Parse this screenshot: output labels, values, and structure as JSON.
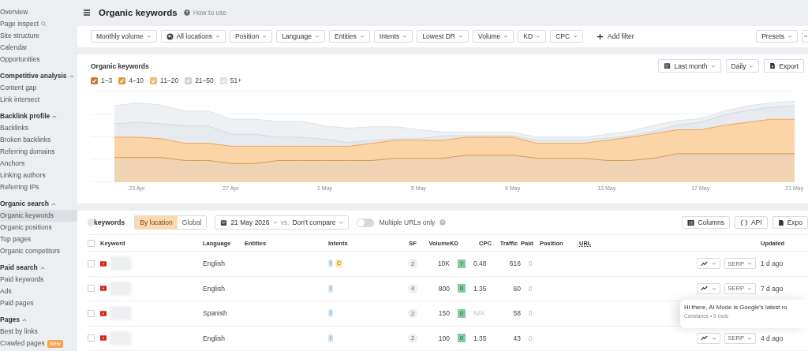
{
  "sidebar": {
    "sections": [
      {
        "items": [
          {
            "label": "Overview",
            "kind": "plain",
            "selected": false
          },
          {
            "label": "Page inspect",
            "kind": "search",
            "selected": false
          },
          {
            "label": "Site structure",
            "kind": "plain",
            "selected": false
          },
          {
            "label": "Calendar",
            "kind": "plain",
            "selected": false
          },
          {
            "label": "Opportunities",
            "kind": "plain",
            "selected": false
          }
        ]
      },
      {
        "heading": "Competitive analysis",
        "expanded": true,
        "items": [
          {
            "label": "Content gap",
            "kind": "plain",
            "selected": false
          },
          {
            "label": "Link intersect",
            "kind": "plain",
            "selected": false
          }
        ]
      },
      {
        "heading": "Backlink profile",
        "expanded": true,
        "items": [
          {
            "label": "Backlinks",
            "kind": "plain",
            "selected": false
          },
          {
            "label": "Broken backlinks",
            "kind": "plain",
            "selected": false
          },
          {
            "label": "Referring domains",
            "kind": "plain",
            "selected": false
          },
          {
            "label": "Anchors",
            "kind": "plain",
            "selected": false
          },
          {
            "label": "Linking authors",
            "kind": "plain",
            "selected": false
          },
          {
            "label": "Referring IPs",
            "kind": "plain",
            "selected": false
          }
        ]
      },
      {
        "heading": "Organic search",
        "expanded": true,
        "items": [
          {
            "label": "Organic keywords",
            "kind": "plain",
            "selected": true
          },
          {
            "label": "Organic positions",
            "kind": "plain",
            "selected": false
          },
          {
            "label": "Top pages",
            "kind": "plain",
            "selected": false
          },
          {
            "label": "Organic competitors",
            "kind": "plain",
            "selected": false
          }
        ]
      },
      {
        "heading": "Paid search",
        "expanded": true,
        "items": [
          {
            "label": "Paid keywords",
            "kind": "plain",
            "selected": false
          },
          {
            "label": "Ads",
            "kind": "plain",
            "selected": false
          },
          {
            "label": "Paid pages",
            "kind": "plain",
            "selected": false
          }
        ]
      },
      {
        "heading": "Pages",
        "expanded": true,
        "items": [
          {
            "label": "Best by links",
            "kind": "plain",
            "selected": false
          },
          {
            "label": "Crawled pages",
            "kind": "plain",
            "selected": false,
            "badge": "New"
          }
        ]
      }
    ]
  },
  "header": {
    "title": "Organic keywords",
    "help": "How to use"
  },
  "filters": [
    {
      "label": "Monthly volume",
      "kind": "dropdown"
    },
    {
      "label": "All locations",
      "kind": "location"
    },
    {
      "label": "Position",
      "kind": "dropdown"
    },
    {
      "label": "Language",
      "kind": "dropdown"
    },
    {
      "label": "Entities",
      "kind": "dropdown"
    },
    {
      "label": "Intents",
      "kind": "dropdown"
    },
    {
      "label": "Lowest DR",
      "kind": "dropdown"
    },
    {
      "label": "Volume",
      "kind": "dropdown"
    },
    {
      "label": "KD",
      "kind": "dropdown"
    },
    {
      "label": "CPC",
      "kind": "dropdown"
    }
  ],
  "add_filter": "Add filter",
  "presets": "Presets",
  "chart_card": {
    "title": "Organic keywords",
    "legend": [
      {
        "label": "1–3",
        "color": "#c8792a"
      },
      {
        "label": "4–10",
        "color": "#e8973c"
      },
      {
        "label": "11–20",
        "color": "#f5b66a"
      },
      {
        "label": "21–50",
        "color": "#c9d3de"
      },
      {
        "label": "51+",
        "color": "#dde3ea"
      }
    ],
    "period": "Last month",
    "interval": "Daily",
    "export": "Export",
    "x_labels": [
      "23 Apr",
      "27 Apr",
      "1 May",
      "5 May",
      "9 May",
      "13 May",
      "17 May",
      "21 May"
    ]
  },
  "table": {
    "title": "keywords",
    "scope": [
      {
        "label": "By location",
        "selected": true
      },
      {
        "label": "Global",
        "selected": false
      }
    ],
    "date": "21 May 2026",
    "vs": "vs.",
    "compare": "Don't compare",
    "multiple_urls": {
      "label": "Multiple URLs only",
      "on": false
    },
    "buttons": [
      {
        "label": "Columns",
        "kind": "columns"
      },
      {
        "label": "API",
        "kind": "api"
      },
      {
        "label": "Expo",
        "kind": "export"
      }
    ],
    "all_checked": false,
    "columns": [
      "Keyword",
      "Language",
      "Entities",
      "Intents",
      "SF",
      "Volume",
      "KD",
      "CPC",
      "Traffic",
      "Paid",
      "Position",
      "URL",
      "Updated"
    ],
    "rows": [
      {
        "checked": false,
        "language": "English",
        "intents": [
          {
            "label": "I",
            "kind": "informational"
          },
          {
            "label": "C",
            "kind": "commercial"
          }
        ],
        "sf": "2",
        "volume": "10K",
        "kd": "7",
        "cpc": "0.48",
        "cpc_available": true,
        "traffic": "616",
        "paid": "0",
        "serp": "SERP",
        "updated": "1 d ago"
      },
      {
        "checked": false,
        "language": "English",
        "intents": [
          {
            "label": "I",
            "kind": "informational"
          }
        ],
        "sf": "4",
        "volume": "800",
        "kd": "0",
        "cpc": "1.35",
        "cpc_available": true,
        "traffic": "60",
        "paid": "0",
        "serp": "SERP",
        "updated": "7 d ago"
      },
      {
        "checked": false,
        "language": "Spanish",
        "intents": [
          {
            "label": "I",
            "kind": "informational"
          }
        ],
        "sf": "2",
        "volume": "150",
        "kd": "0",
        "cpc": "N/A",
        "cpc_available": false,
        "traffic": "58",
        "paid": "0"
      },
      {
        "checked": false,
        "language": "English",
        "intents": [
          {
            "label": "I",
            "kind": "informational"
          }
        ],
        "sf": "2",
        "volume": "100",
        "kd": "0",
        "cpc": "1.35",
        "cpc_available": true,
        "traffic": "43",
        "paid": "0",
        "serp": "SERP",
        "updated": "4 d ago"
      }
    ]
  },
  "popup": {
    "message": "Hi there,  AI Mode is Google's latest ro",
    "author": "Constance • 5 mois"
  }
}
